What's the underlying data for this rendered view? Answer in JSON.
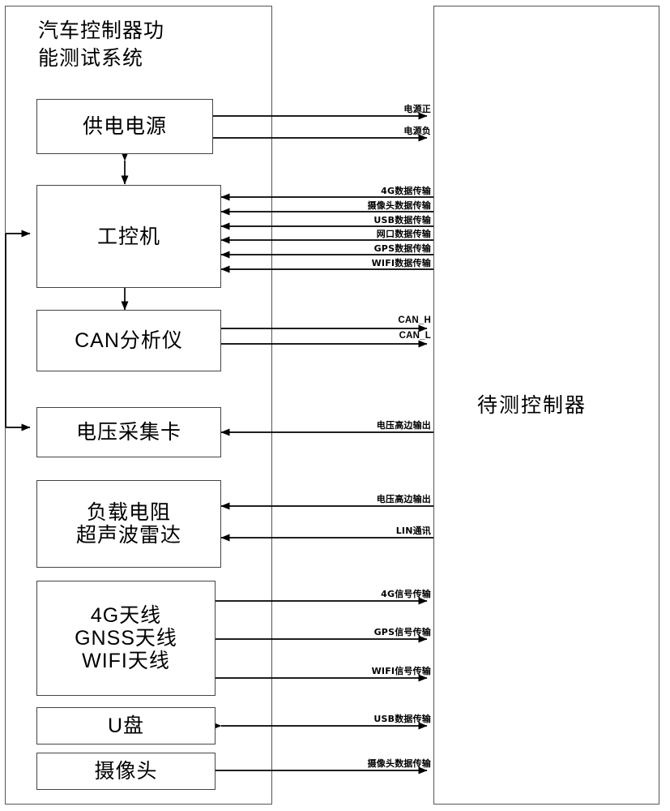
{
  "diagram": {
    "title_lines": "汽车控制器功\n能测试系统",
    "left_container_name": "汽车控制器功能测试系统",
    "right_container_label": "待测控制器",
    "boxes": [
      {
        "id": "power-supply",
        "label": "供电电源"
      },
      {
        "id": "industrial-pc",
        "label": "工控机"
      },
      {
        "id": "can-analyzer",
        "label": "CAN分析仪"
      },
      {
        "id": "voltage-acquisition-card",
        "label": "电压采集卡"
      },
      {
        "id": "load-resistor-ultrasonic-radar",
        "label_line1": "负载电阻",
        "label_line2": "超声波雷达"
      },
      {
        "id": "antennas",
        "label_line1": "4G天线",
        "label_line2": "GNSS天线",
        "label_line3": "WIFI天线"
      },
      {
        "id": "usb-drive",
        "label": "U盘"
      },
      {
        "id": "camera",
        "label": "摄像头"
      }
    ],
    "signals": [
      {
        "id": "power-positive",
        "label": "电源正",
        "direction": "right"
      },
      {
        "id": "power-negative",
        "label": "电源负",
        "direction": "right"
      },
      {
        "id": "4g-data",
        "label": "4G数据传输",
        "direction": "left"
      },
      {
        "id": "camera-data-pc",
        "label": "摄像头数据传输",
        "direction": "left"
      },
      {
        "id": "usb-data-pc",
        "label": "USB数据传输",
        "direction": "left"
      },
      {
        "id": "ethernet-data",
        "label": "网口数据传输",
        "direction": "left"
      },
      {
        "id": "gps-data",
        "label": "GPS数据传输",
        "direction": "left"
      },
      {
        "id": "wifi-data",
        "label": "WIFI数据传输",
        "direction": "left"
      },
      {
        "id": "can-high",
        "label": "CAN_H",
        "direction": "both"
      },
      {
        "id": "can-low",
        "label": "CAN_L",
        "direction": "both"
      },
      {
        "id": "voltage-high-side-output-1",
        "label": "电压高边输出",
        "direction": "left"
      },
      {
        "id": "voltage-high-side-output-2",
        "label": "电压高边输出",
        "direction": "left"
      },
      {
        "id": "lin-communication",
        "label": "LIN通讯",
        "direction": "left"
      },
      {
        "id": "4g-signal",
        "label": "4G信号传输",
        "direction": "right"
      },
      {
        "id": "gps-signal",
        "label": "GPS信号传输",
        "direction": "right"
      },
      {
        "id": "wifi-signal",
        "label": "WIFI信号传输",
        "direction": "right"
      },
      {
        "id": "usb-data-drive",
        "label": "USB数据传输",
        "direction": "both"
      },
      {
        "id": "camera-data",
        "label": "摄像头数据传输",
        "direction": "right"
      }
    ],
    "colors": {
      "line": "#000000",
      "box_border": "#444444",
      "container_border": "#555555",
      "background": "#ffffff",
      "text": "#000000"
    }
  }
}
